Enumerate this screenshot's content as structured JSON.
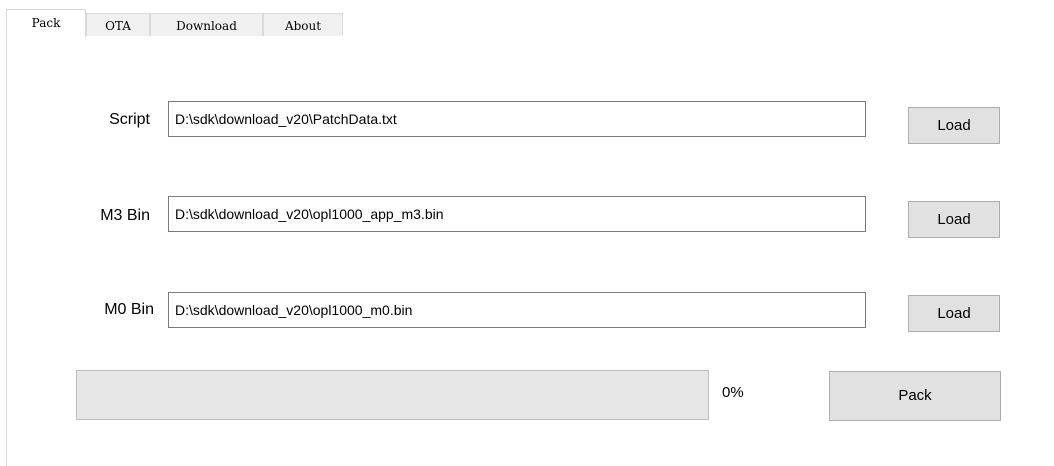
{
  "tabs": [
    {
      "label": "Pack",
      "active": true
    },
    {
      "label": "OTA",
      "active": false
    },
    {
      "label": "Download",
      "active": false
    },
    {
      "label": "About",
      "active": false
    }
  ],
  "pack": {
    "script": {
      "label": "Script",
      "value": "D:\\sdk\\download_v20\\PatchData.txt",
      "button": "Load"
    },
    "m3_bin": {
      "label": "M3 Bin",
      "value": "D:\\sdk\\download_v20\\opl1000_app_m3.bin",
      "button": "Load"
    },
    "m0_bin": {
      "label": "M0 Bin",
      "value": "D:\\sdk\\download_v20\\opl1000_m0.bin",
      "button": "Load"
    },
    "progress": {
      "value": 0,
      "text": "0%"
    },
    "pack_button": "Pack"
  }
}
